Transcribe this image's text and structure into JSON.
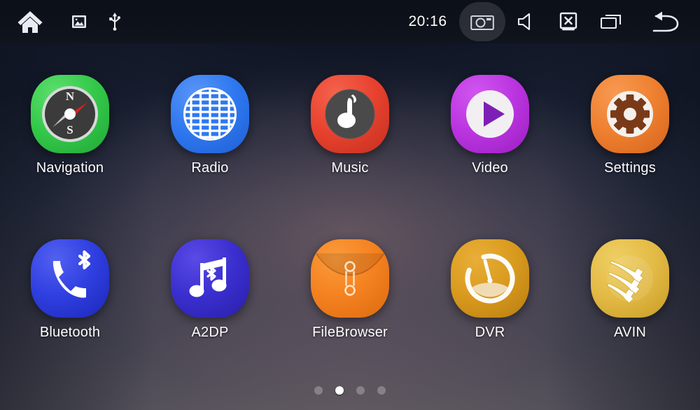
{
  "statusbar": {
    "clock": "20:16",
    "left_items": [
      {
        "name": "home-icon",
        "label": "Home"
      },
      {
        "name": "gallery-icon",
        "label": "Gallery"
      },
      {
        "name": "usb-icon",
        "label": "USB"
      }
    ],
    "right_items": [
      {
        "name": "camera-icon",
        "label": "Camera",
        "pressed": true
      },
      {
        "name": "volume-icon",
        "label": "Volume"
      },
      {
        "name": "screen-off-icon",
        "label": "Screen Off"
      },
      {
        "name": "recent-apps-icon",
        "label": "Recent Apps"
      },
      {
        "name": "back-icon",
        "label": "Back"
      }
    ]
  },
  "apps": [
    {
      "label": "Navigation",
      "icon": "compass-icon",
      "color": "#34c94a"
    },
    {
      "label": "Radio",
      "icon": "radio-grille-icon",
      "color": "#2f78f0"
    },
    {
      "label": "Music",
      "icon": "music-disc-icon",
      "color": "#e8422f"
    },
    {
      "label": "Video",
      "icon": "video-play-icon",
      "color": "#bb35e0"
    },
    {
      "label": "Settings",
      "icon": "gear-icon",
      "color": "#ef8030"
    },
    {
      "label": "Bluetooth",
      "icon": "bt-phone-icon",
      "color": "#2f3fe0"
    },
    {
      "label": "A2DP",
      "icon": "bt-music-icon",
      "color": "#3a2fcf"
    },
    {
      "label": "FileBrowser",
      "icon": "envelope-icon",
      "color": "#f58220"
    },
    {
      "label": "DVR",
      "icon": "gauge-icon",
      "color": "#d99b1e"
    },
    {
      "label": "AVIN",
      "icon": "rca-cables-icon",
      "color": "#e3bb46"
    }
  ],
  "pager": {
    "count": 4,
    "active_index": 1
  },
  "colors": {
    "statusbar_bg": "#0d1119",
    "label_text": "#ffffff",
    "dot_active": "#ffffff",
    "dot_inactive": "rgba(255,255,255,0.26)"
  }
}
